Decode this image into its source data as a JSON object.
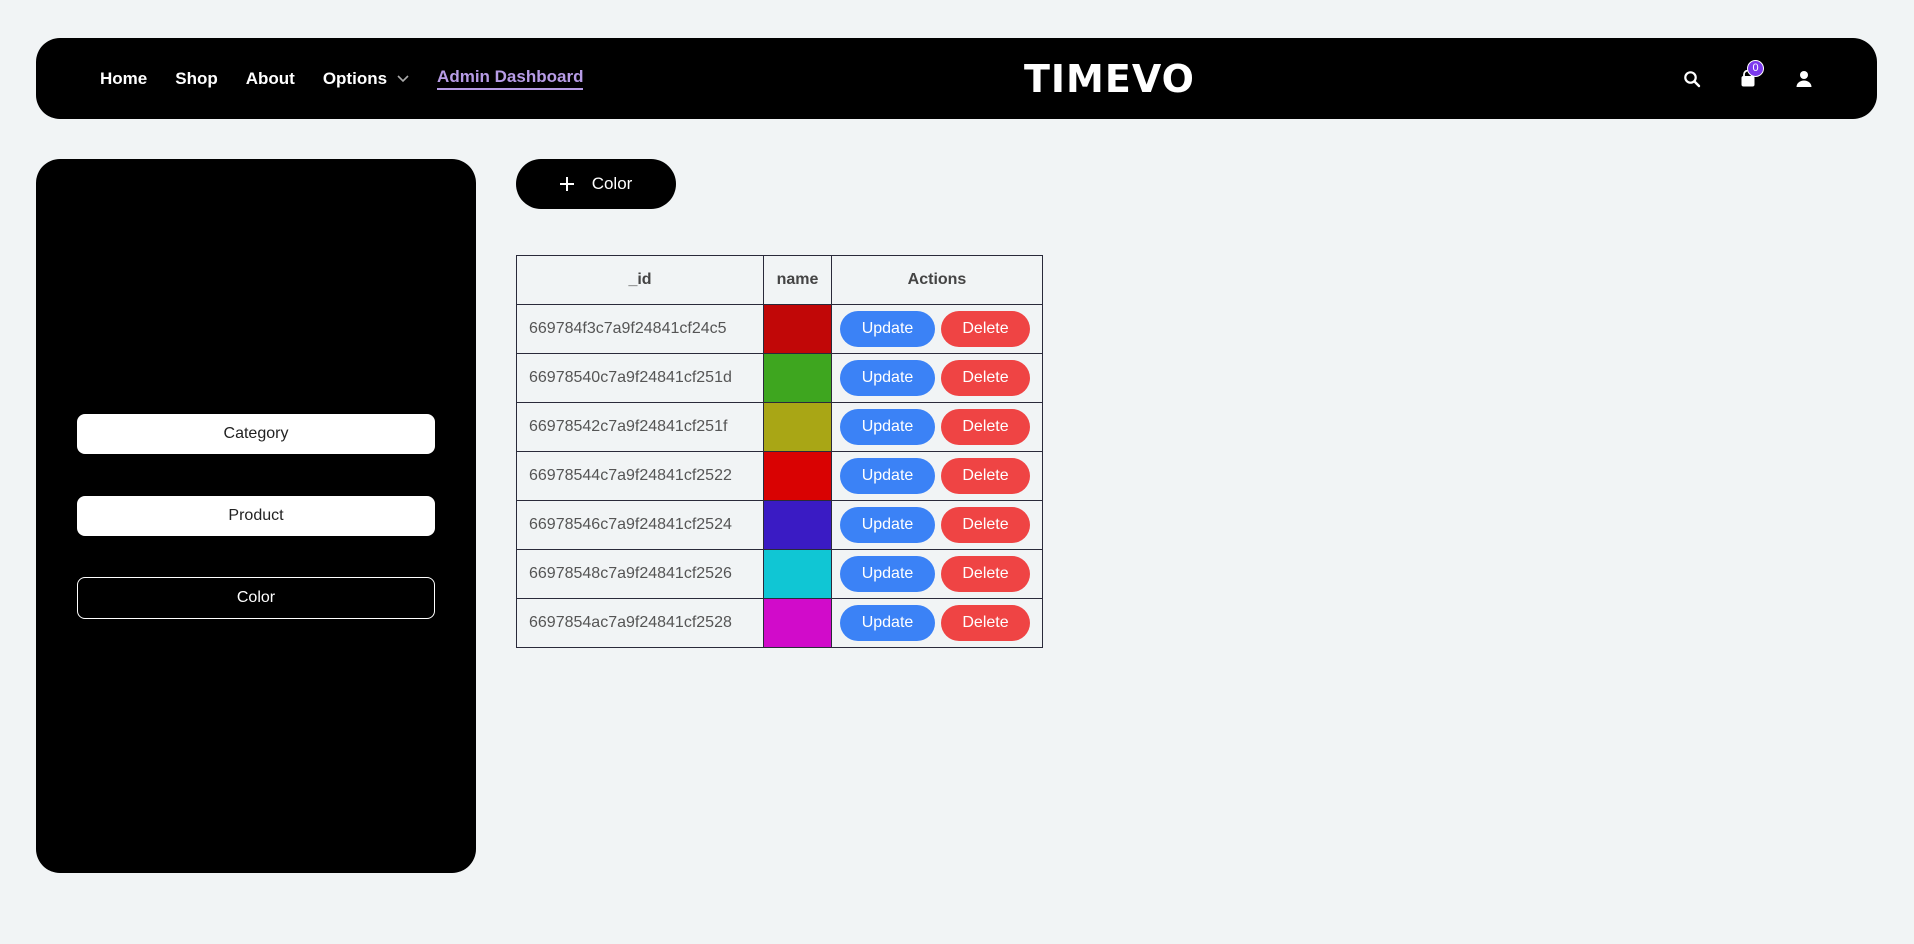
{
  "nav": {
    "links": [
      "Home",
      "Shop",
      "About",
      "Options",
      "Admin Dashboard"
    ],
    "logo": "TIMEVO",
    "cart_count": "0"
  },
  "sidebar": {
    "items": [
      "Category",
      "Product",
      "Color"
    ],
    "active": "Color"
  },
  "toolbar": {
    "add_label": "Color"
  },
  "table": {
    "headers": [
      "_id",
      "name",
      "Actions"
    ],
    "update_label": "Update",
    "delete_label": "Delete",
    "rows": [
      {
        "id": "669784f3c7a9f24841cf24c5",
        "color": "#c10707"
      },
      {
        "id": "66978540c7a9f24841cf251d",
        "color": "#3ea61f"
      },
      {
        "id": "66978542c7a9f24841cf251f",
        "color": "#a9a615"
      },
      {
        "id": "66978544c7a9f24841cf2522",
        "color": "#d90202"
      },
      {
        "id": "66978546c7a9f24841cf2524",
        "color": "#3a1bc4"
      },
      {
        "id": "66978548c7a9f24841cf2526",
        "color": "#10c6d4"
      },
      {
        "id": "6697854ac7a9f24841cf2528",
        "color": "#d10bca"
      }
    ]
  },
  "colors": {
    "accent": "#b79ce6",
    "update": "#3b82f6",
    "delete": "#ef4444",
    "badge": "#7c3aed"
  }
}
